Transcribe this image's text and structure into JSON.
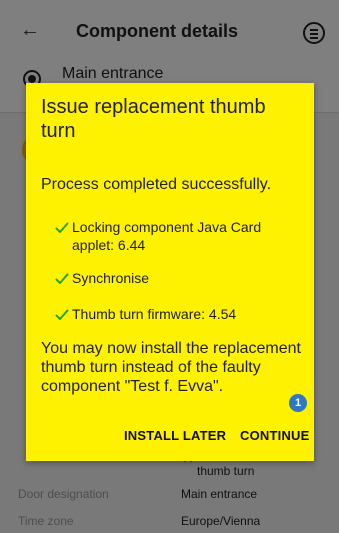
{
  "app_bar": {
    "title": "Component details"
  },
  "subheader": {
    "title": "Main entrance"
  },
  "details": {
    "door_designation": {
      "label": "Door designation",
      "value": "Main entrance"
    },
    "time_zone": {
      "label": "Time zone",
      "value": "Europe/Vienna"
    },
    "remove_thumb_turn_label": "thumb turn"
  },
  "dialog": {
    "title": "Issue replacement thumb turn",
    "message": "Process completed successfully.",
    "steps": [
      {
        "label": "Locking component Java Card applet: 6.44"
      },
      {
        "label": "Synchronise"
      },
      {
        "label": "Thumb turn firmware: 4.54"
      }
    ],
    "note": "You may now install the replacement thumb turn instead of the faulty component \"Test f. Evva\".",
    "buttons": {
      "install_later": "INSTALL LATER",
      "continue": "CONTINUE"
    },
    "badge_count": "1"
  },
  "colors": {
    "dialog_background": "#fff200",
    "check": "#2aa22a",
    "badge": "#2f78c5"
  },
  "icons": {
    "back": "back-arrow-icon",
    "menu": "menu-icon",
    "radio": "radio-icon",
    "check": "check-icon"
  }
}
